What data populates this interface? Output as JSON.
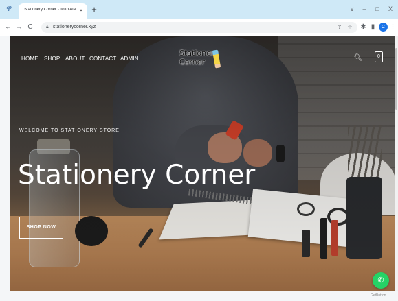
{
  "browser": {
    "tab_title": "Stationery Corner - Toko Alat Tul...",
    "tab_close": "×",
    "new_tab": "+",
    "url": "stationerycorner.xyz",
    "profile_letter": "C",
    "controls": {
      "minimize": "–",
      "maximize": "□",
      "close": "X",
      "tab_list": "∨"
    }
  },
  "site": {
    "nav": [
      "HOME",
      "SHOP",
      "ABOUT",
      "CONTACT",
      "ADMIN"
    ],
    "brand_line1": "Stationery",
    "brand_line2": "Corner",
    "cart_count": "0"
  },
  "hero": {
    "welcome": "WELCOME TO STATIONERY STORE",
    "title": "Stationery Corner",
    "cta": "SHOP NOW"
  },
  "widget": {
    "getbutton": "GetButton"
  },
  "colors": {
    "tabbar": "#cfe9f7",
    "whatsapp": "#25d366",
    "profile": "#1a73e8"
  }
}
